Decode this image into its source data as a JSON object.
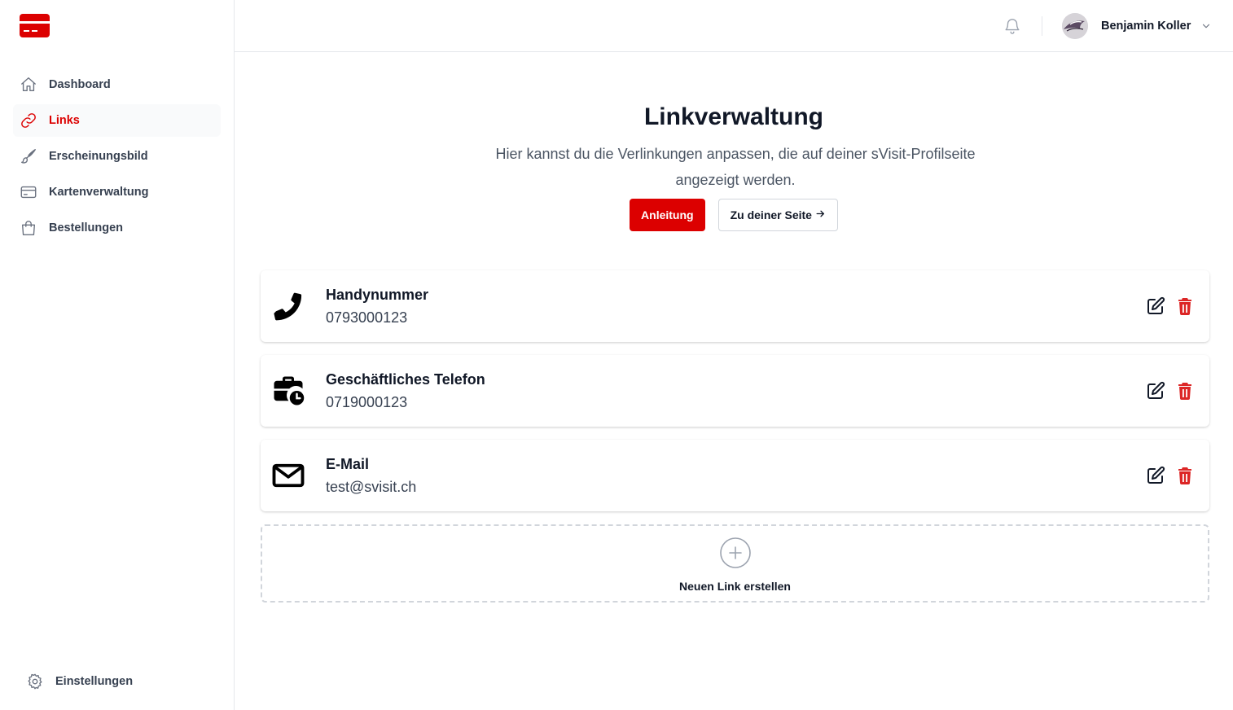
{
  "colors": {
    "brand": "#dc0000",
    "text": "#111827",
    "muted": "#4b5563",
    "border": "#e5e7eb"
  },
  "sidebar": {
    "items": [
      {
        "label": "Dashboard",
        "icon": "home-icon",
        "active": false
      },
      {
        "label": "Links",
        "icon": "link-icon",
        "active": true
      },
      {
        "label": "Erscheinungsbild",
        "icon": "brush-icon",
        "active": false
      },
      {
        "label": "Kartenverwaltung",
        "icon": "credit-card-icon",
        "active": false
      },
      {
        "label": "Bestellungen",
        "icon": "shopping-bag-icon",
        "active": false
      }
    ],
    "settings_label": "Einstellungen"
  },
  "header": {
    "user_name": "Benjamin Koller"
  },
  "main": {
    "title": "Linkverwaltung",
    "description": "Hier kannst du die Verlinkungen anpassen, die auf deiner sVisit-Profilseite angezeigt werden.",
    "guide_button": "Anleitung",
    "page_button": "Zu deiner Seite",
    "links": [
      {
        "title": "Handynummer",
        "value": "0793000123",
        "icon": "phone-icon"
      },
      {
        "title": "Geschäftliches Telefon",
        "value": "0719000123",
        "icon": "business-phone-icon"
      },
      {
        "title": "E-Mail",
        "value": "test@svisit.ch",
        "icon": "envelope-icon"
      }
    ],
    "add_link_label": "Neuen Link erstellen"
  }
}
